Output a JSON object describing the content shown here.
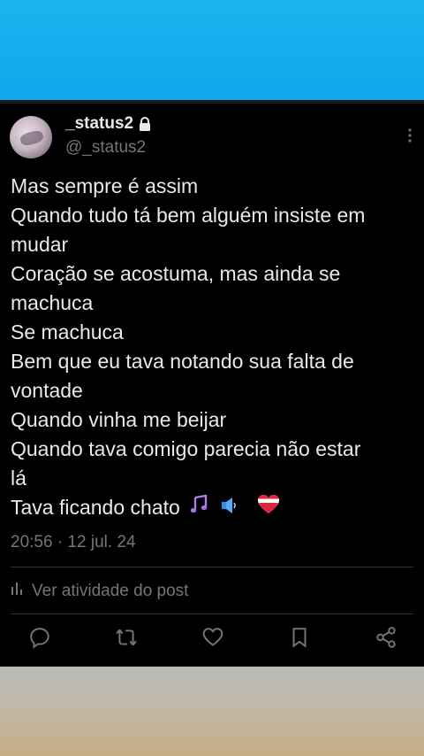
{
  "post": {
    "display_name": "_status2",
    "handle": "@_status2",
    "text_lines": [
      "Mas sempre é assim",
      "Quando tudo tá bem alguém insiste em",
      "mudar",
      "Coração se acostuma, mas ainda se",
      "machuca",
      "Se machuca",
      "Bem que eu tava notando sua falta de",
      "vontade",
      "Quando vinha me beijar",
      "Quando tava comigo parecia não estar",
      "lá",
      "Tava ficando chato"
    ],
    "emojis": [
      "music-notes-emoji",
      "speaker-emoji",
      "heart-emoji"
    ],
    "timestamp": "20:56 · 12 jul. 24",
    "activity_label": "Ver atividade do post"
  },
  "colors": {
    "top_background": "#1cb3ef",
    "card_background": "#000000",
    "primary_text": "#e7e9ea",
    "secondary_text": "#71767b",
    "separator": "#2f3336"
  },
  "icons": {
    "lock": "lock-icon",
    "more": "more-vertical-icon",
    "activity": "bar-chart-icon",
    "reply": "reply-icon",
    "repost": "repost-icon",
    "like": "like-icon",
    "bookmark": "bookmark-icon",
    "share": "share-icon"
  }
}
